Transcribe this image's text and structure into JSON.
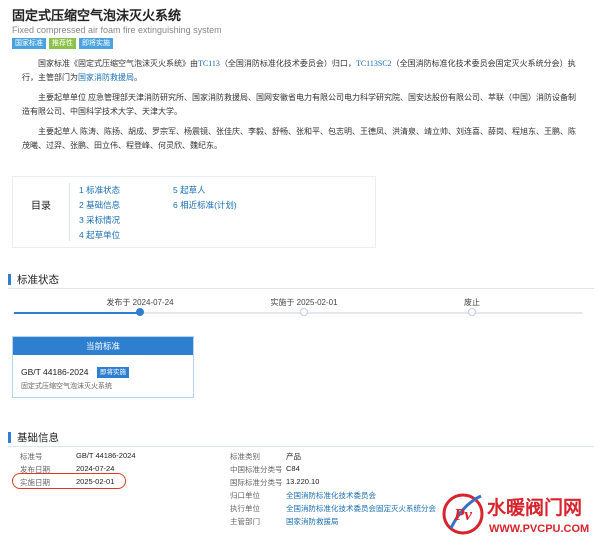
{
  "header": {
    "title": "固定式压缩空气泡沫灭火系统",
    "subtitle": "Fixed compressed air foam fire extinguishing system",
    "badges": [
      {
        "label": "国家标准",
        "color": "#4aa3df"
      },
      {
        "label": "推荐性",
        "color": "#8bc34a"
      },
      {
        "label": "即将实施",
        "color": "#4aa3df"
      }
    ]
  },
  "intro": {
    "p1_pre": "国家标准《固定式压缩空气泡沫灭火系统》由",
    "p1_tc": "TC113",
    "p1_mid": "（全国消防标准化技术委员会）归口，",
    "p1_sc": "TC113SC2",
    "p1_mid2": "（全国消防标准化技术委员会固定灭火系统分会）执行，主管部门为",
    "p1_dept": "国家消防救援局",
    "p1_end": "。",
    "p2": "主要起草单位 应急管理部天津消防研究所、国家消防救援局、国网安徽省电力有限公司电力科学研究院、国安达股份有限公司、萃联（中国）消防设备制造有限公司、中国科学技术大学、天津大学。",
    "p3": "主要起草人 陈涛、陈扬、胡成、罗宗军、杨震镜、张佳庆、李毅、舒畅、张和平、包志明、王德凤、洪清泉、靖立帅、刘连喜、薛岗、程旭东、王鹏、陈茂曦、过羿、张鹏、田立伟、程登峰、何灵欣、魏纪东。"
  },
  "toc": {
    "title": "目录",
    "col1": [
      "1  标准状态",
      "2  基础信息",
      "3  采标情况",
      "4  起草单位"
    ],
    "col2": [
      "5  起草人",
      "6  相近标准(计划)"
    ]
  },
  "status": {
    "heading": "标准状态",
    "published": "发布于 2024-07-24",
    "implemented": "实施于 2025-02-01",
    "abolished": "废止",
    "progress": 0.22
  },
  "current": {
    "head": "当前标准",
    "code": "GB/T 44186-2024",
    "badge": "即将实施",
    "name": "固定式压缩空气泡沫灭火系统"
  },
  "basic": {
    "heading": "基础信息",
    "left": [
      {
        "label": "标准号",
        "value": "GB/T 44186-2024"
      },
      {
        "label": "发布日期",
        "value": "2024-07-24"
      },
      {
        "label": "实施日期",
        "value": "2025-02-01"
      }
    ],
    "right": [
      {
        "label": "标准类别",
        "value": "产品"
      },
      {
        "label": "中国标准分类号",
        "value": "C84"
      },
      {
        "label": "国际标准分类号",
        "value": "13.220.10"
      },
      {
        "label": "归口单位",
        "value": "全国消防标准化技术委员会"
      },
      {
        "label": "执行单位",
        "value": "全国消防标准化技术委员会固定灭火系统分会"
      },
      {
        "label": "主管部门",
        "value": "国家消防救援局"
      }
    ]
  },
  "watermark": {
    "brand": "水暖阀门网",
    "url": "WWW.PVCPU.COM",
    "logo_letter": "Pv"
  },
  "colors": {
    "accent": "#2f7fd0",
    "link": "#1a6fb5",
    "highlight": "#e0391f",
    "brand_red": "#d8242c"
  }
}
